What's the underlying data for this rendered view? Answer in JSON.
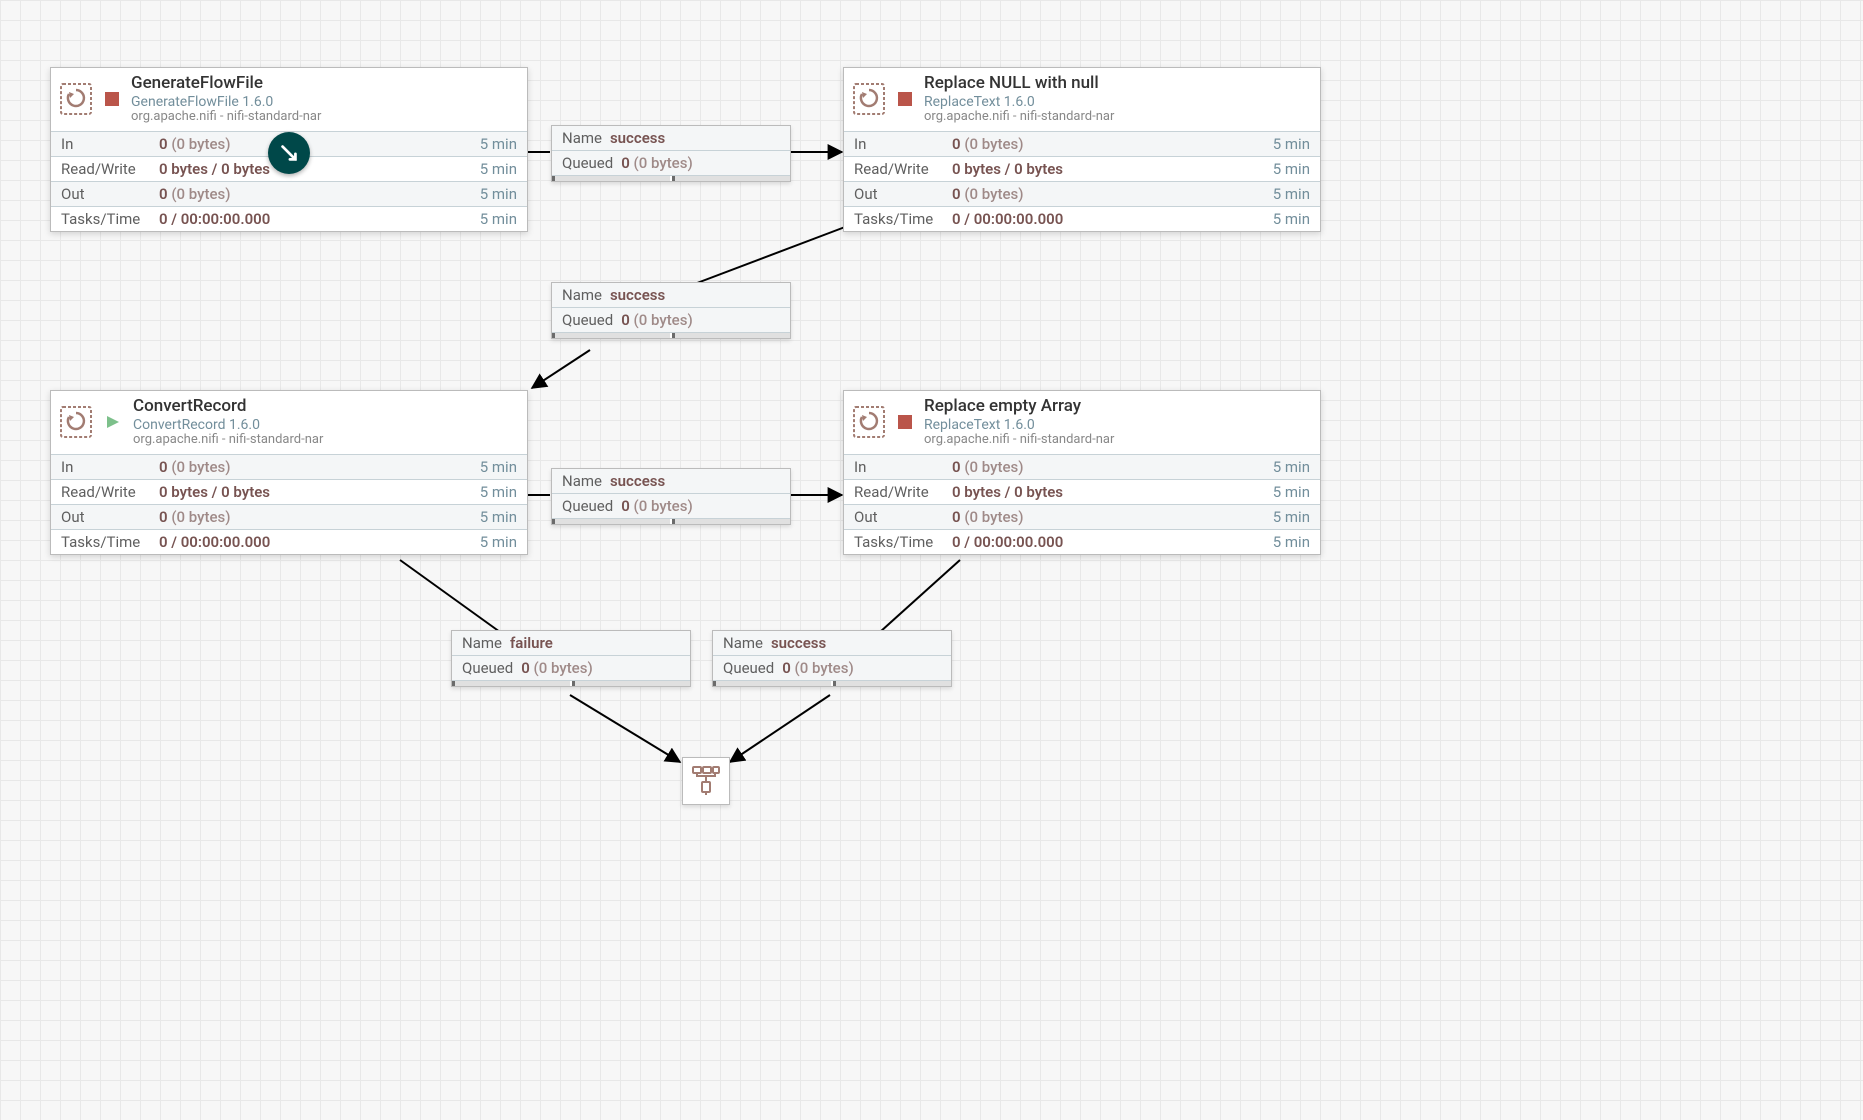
{
  "labels": {
    "in": "In",
    "readwrite": "Read/Write",
    "out": "Out",
    "tasks": "Tasks/Time",
    "name": "Name",
    "queued": "Queued",
    "window": "5 min"
  },
  "processors": [
    {
      "title": "GenerateFlowFile",
      "type": "GenerateFlowFile 1.6.0",
      "bundle": "org.apache.nifi - nifi-standard-nar",
      "state": "stopped",
      "in_v": "0",
      "in_b": "(0 bytes)",
      "rw": "0 bytes / 0 bytes",
      "out_v": "0",
      "out_b": "(0 bytes)",
      "tasks": "0 / 00:00:00.000"
    },
    {
      "title": "Replace NULL with null",
      "type": "ReplaceText 1.6.0",
      "bundle": "org.apache.nifi - nifi-standard-nar",
      "state": "stopped",
      "in_v": "0",
      "in_b": "(0 bytes)",
      "rw": "0 bytes / 0 bytes",
      "out_v": "0",
      "out_b": "(0 bytes)",
      "tasks": "0 / 00:00:00.000"
    },
    {
      "title": "ConvertRecord",
      "type": "ConvertRecord 1.6.0",
      "bundle": "org.apache.nifi - nifi-standard-nar",
      "state": "running",
      "in_v": "0",
      "in_b": "(0 bytes)",
      "rw": "0 bytes / 0 bytes",
      "out_v": "0",
      "out_b": "(0 bytes)",
      "tasks": "0 / 00:00:00.000"
    },
    {
      "title": "Replace empty Array",
      "type": "ReplaceText 1.6.0",
      "bundle": "org.apache.nifi - nifi-standard-nar",
      "state": "stopped",
      "in_v": "0",
      "in_b": "(0 bytes)",
      "rw": "0 bytes / 0 bytes",
      "out_v": "0",
      "out_b": "(0 bytes)",
      "tasks": "0 / 00:00:00.000"
    }
  ],
  "connections": [
    {
      "name": "success",
      "q_v": "0",
      "q_b": "(0 bytes)"
    },
    {
      "name": "success",
      "q_v": "0",
      "q_b": "(0 bytes)"
    },
    {
      "name": "success",
      "q_v": "0",
      "q_b": "(0 bytes)"
    },
    {
      "name": "failure",
      "q_v": "0",
      "q_b": "(0 bytes)"
    },
    {
      "name": "success",
      "q_v": "0",
      "q_b": "(0 bytes)"
    }
  ]
}
